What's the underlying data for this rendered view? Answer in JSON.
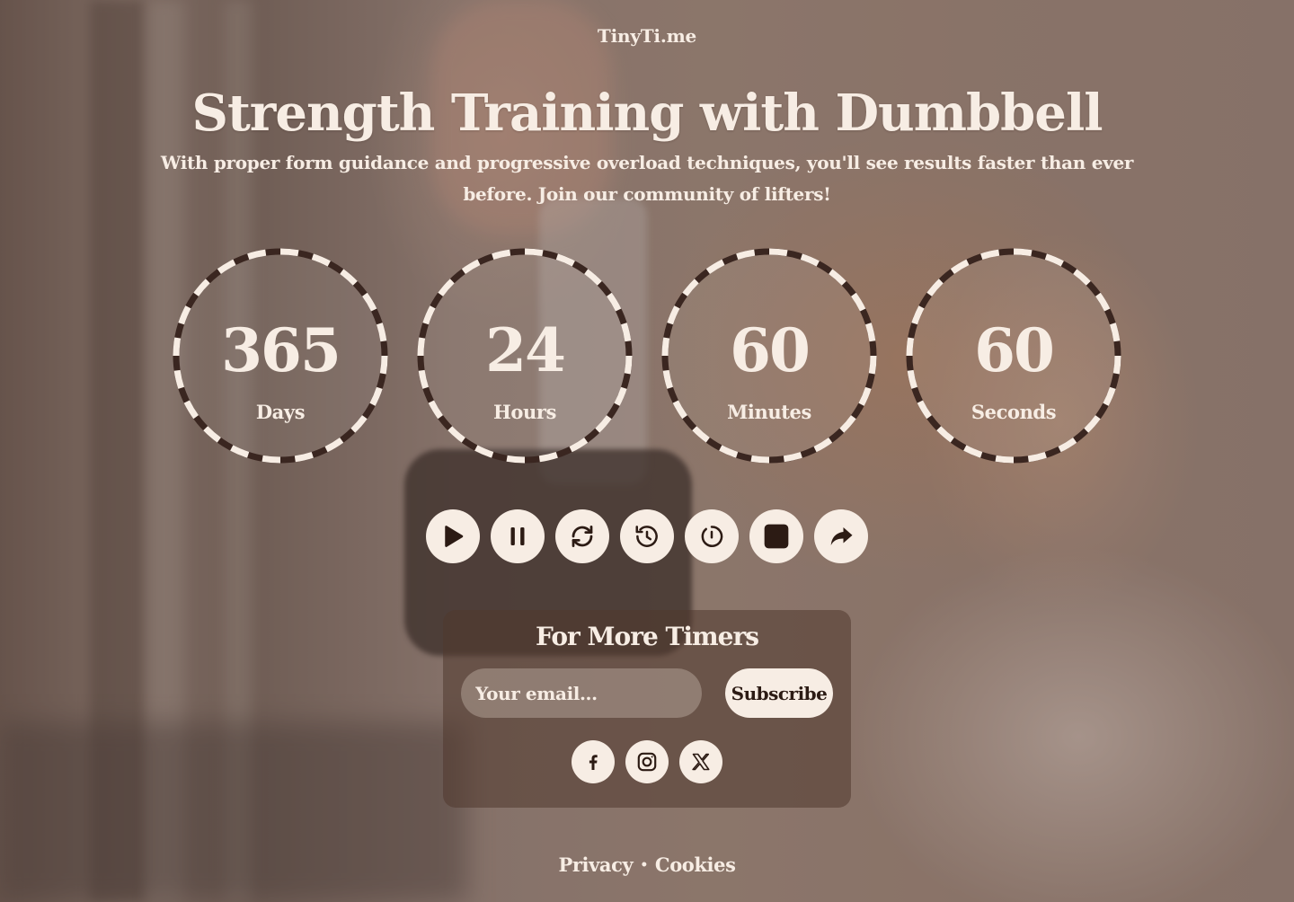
{
  "brand": "TinyTi.me",
  "title": "Strength Training with Dumbbell",
  "subtitle": "With proper form guidance and progressive overload techniques, you'll see results faster than ever before. Join our community of lifters!",
  "timers": [
    {
      "value": "365",
      "label": "Days"
    },
    {
      "value": "24",
      "label": "Hours"
    },
    {
      "value": "60",
      "label": "Minutes"
    },
    {
      "value": "60",
      "label": "Seconds"
    }
  ],
  "controls": [
    {
      "name": "play-icon"
    },
    {
      "name": "pause-icon"
    },
    {
      "name": "refresh-icon"
    },
    {
      "name": "rewind-icon"
    },
    {
      "name": "restart-icon"
    },
    {
      "name": "stop-icon"
    },
    {
      "name": "share-icon"
    }
  ],
  "newsletter": {
    "title": "For More Timers",
    "email_placeholder": "Your email...",
    "subscribe_label": "Subscribe"
  },
  "social": [
    "facebook-icon",
    "instagram-icon",
    "x-icon"
  ],
  "footer": {
    "privacy": "Privacy",
    "separator": "•",
    "cookies": "Cookies"
  },
  "colors": {
    "cream": "#f7ede4",
    "dark": "#2c1b14",
    "panel": "#50382e"
  }
}
